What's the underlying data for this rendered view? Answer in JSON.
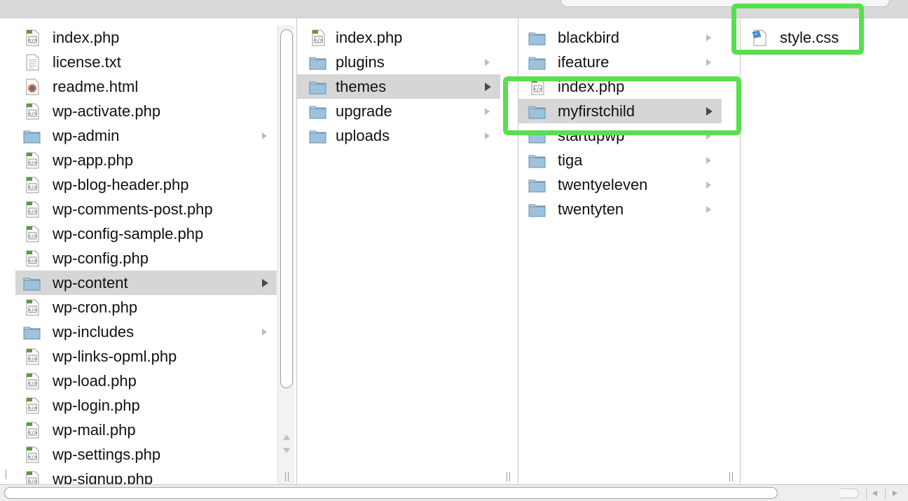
{
  "colors": {
    "selection": "#d6d6d6",
    "highlight": "#56e04b",
    "folder": "#9dc2de",
    "php_icon": "#5f9a3c"
  },
  "columns": [
    {
      "items": [
        {
          "name": "index.php",
          "kind": "php-file",
          "has_children": false,
          "selected": false
        },
        {
          "name": "license.txt",
          "kind": "text-file",
          "has_children": false,
          "selected": false
        },
        {
          "name": "readme.html",
          "kind": "html-file",
          "has_children": false,
          "selected": false
        },
        {
          "name": "wp-activate.php",
          "kind": "php-file",
          "has_children": false,
          "selected": false
        },
        {
          "name": "wp-admin",
          "kind": "folder",
          "has_children": true,
          "selected": false
        },
        {
          "name": "wp-app.php",
          "kind": "php-file",
          "has_children": false,
          "selected": false
        },
        {
          "name": "wp-blog-header.php",
          "kind": "php-file",
          "has_children": false,
          "selected": false
        },
        {
          "name": "wp-comments-post.php",
          "kind": "php-file",
          "has_children": false,
          "selected": false
        },
        {
          "name": "wp-config-sample.php",
          "kind": "php-file",
          "has_children": false,
          "selected": false
        },
        {
          "name": "wp-config.php",
          "kind": "php-file",
          "has_children": false,
          "selected": false
        },
        {
          "name": "wp-content",
          "kind": "folder",
          "has_children": true,
          "selected": true
        },
        {
          "name": "wp-cron.php",
          "kind": "php-file",
          "has_children": false,
          "selected": false
        },
        {
          "name": "wp-includes",
          "kind": "folder",
          "has_children": true,
          "selected": false
        },
        {
          "name": "wp-links-opml.php",
          "kind": "php-file",
          "has_children": false,
          "selected": false
        },
        {
          "name": "wp-load.php",
          "kind": "php-file",
          "has_children": false,
          "selected": false
        },
        {
          "name": "wp-login.php",
          "kind": "php-file",
          "has_children": false,
          "selected": false
        },
        {
          "name": "wp-mail.php",
          "kind": "php-file",
          "has_children": false,
          "selected": false
        },
        {
          "name": "wp-settings.php",
          "kind": "php-file",
          "has_children": false,
          "selected": false
        },
        {
          "name": "wp-signup.php",
          "kind": "php-file",
          "has_children": false,
          "selected": false
        }
      ]
    },
    {
      "items": [
        {
          "name": "index.php",
          "kind": "php-file",
          "has_children": false,
          "selected": false
        },
        {
          "name": "plugins",
          "kind": "folder",
          "has_children": true,
          "selected": false
        },
        {
          "name": "themes",
          "kind": "folder",
          "has_children": true,
          "selected": true
        },
        {
          "name": "upgrade",
          "kind": "folder",
          "has_children": true,
          "selected": false
        },
        {
          "name": "uploads",
          "kind": "folder",
          "has_children": true,
          "selected": false
        }
      ]
    },
    {
      "items": [
        {
          "name": "blackbird",
          "kind": "folder",
          "has_children": true,
          "selected": false
        },
        {
          "name": "ifeature",
          "kind": "folder",
          "has_children": true,
          "selected": false
        },
        {
          "name": "index.php",
          "kind": "php-file",
          "has_children": false,
          "selected": false
        },
        {
          "name": "myfirstchild",
          "kind": "folder",
          "has_children": true,
          "selected": true
        },
        {
          "name": "startupwp",
          "kind": "folder",
          "has_children": true,
          "selected": false
        },
        {
          "name": "tiga",
          "kind": "folder",
          "has_children": true,
          "selected": false
        },
        {
          "name": "twentyeleven",
          "kind": "folder",
          "has_children": true,
          "selected": false
        },
        {
          "name": "twentyten",
          "kind": "folder",
          "has_children": true,
          "selected": false
        }
      ]
    },
    {
      "items": [
        {
          "name": "style.css",
          "kind": "css-file",
          "has_children": false,
          "selected": false
        }
      ]
    }
  ]
}
